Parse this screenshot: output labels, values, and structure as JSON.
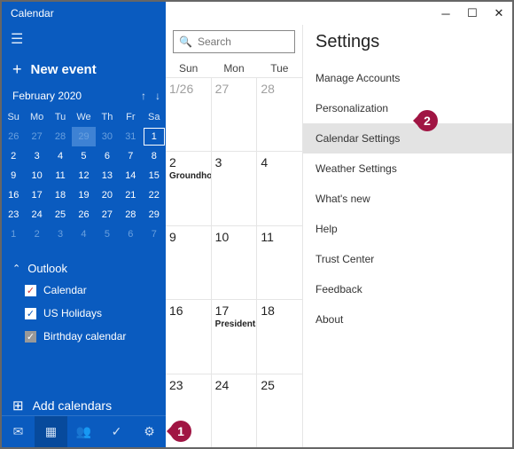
{
  "app_title": "Calendar",
  "sysbtns": {
    "min": "─",
    "max": "☐",
    "close": "✕"
  },
  "newevent": {
    "plus": "+",
    "label": "New event"
  },
  "month_label": "February 2020",
  "weekdays": [
    "Su",
    "Mo",
    "Tu",
    "We",
    "Th",
    "Fr",
    "Sa"
  ],
  "minical": [
    [
      {
        "d": "26",
        "dim": true
      },
      {
        "d": "27",
        "dim": true
      },
      {
        "d": "28",
        "dim": true
      },
      {
        "d": "29",
        "dim": true,
        "sel": true
      },
      {
        "d": "30",
        "dim": true
      },
      {
        "d": "31",
        "dim": true
      },
      {
        "d": "1",
        "today": true
      }
    ],
    [
      {
        "d": "2"
      },
      {
        "d": "3"
      },
      {
        "d": "4"
      },
      {
        "d": "5"
      },
      {
        "d": "6"
      },
      {
        "d": "7"
      },
      {
        "d": "8"
      }
    ],
    [
      {
        "d": "9"
      },
      {
        "d": "10"
      },
      {
        "d": "11"
      },
      {
        "d": "12"
      },
      {
        "d": "13"
      },
      {
        "d": "14"
      },
      {
        "d": "15"
      }
    ],
    [
      {
        "d": "16"
      },
      {
        "d": "17"
      },
      {
        "d": "18"
      },
      {
        "d": "19"
      },
      {
        "d": "20"
      },
      {
        "d": "21"
      },
      {
        "d": "22"
      }
    ],
    [
      {
        "d": "23"
      },
      {
        "d": "24"
      },
      {
        "d": "25"
      },
      {
        "d": "26"
      },
      {
        "d": "27"
      },
      {
        "d": "28"
      },
      {
        "d": "29"
      }
    ],
    [
      {
        "d": "1",
        "dim": true
      },
      {
        "d": "2",
        "dim": true
      },
      {
        "d": "3",
        "dim": true
      },
      {
        "d": "4",
        "dim": true
      },
      {
        "d": "5",
        "dim": true
      },
      {
        "d": "6",
        "dim": true
      },
      {
        "d": "7",
        "dim": true
      }
    ]
  ],
  "outlook_label": "Outlook",
  "calendars": [
    {
      "label": "Calendar",
      "variant": "red"
    },
    {
      "label": "US Holidays",
      "variant": "blue"
    },
    {
      "label": "Birthday calendar",
      "variant": "gray"
    }
  ],
  "add_calendars": "Add calendars",
  "search_placeholder": "Search",
  "big_weekdays": [
    "Sun",
    "Mon",
    "Tue"
  ],
  "weeks": [
    [
      {
        "n": "1/26",
        "dim": true
      },
      {
        "n": "27",
        "dim": true
      },
      {
        "n": "28",
        "dim": true
      }
    ],
    [
      {
        "n": "2",
        "evt": "Groundhog"
      },
      {
        "n": "3"
      },
      {
        "n": "4"
      }
    ],
    [
      {
        "n": "9"
      },
      {
        "n": "10"
      },
      {
        "n": "11"
      }
    ],
    [
      {
        "n": "16"
      },
      {
        "n": "17",
        "evt": "Presidents'"
      },
      {
        "n": "18"
      }
    ],
    [
      {
        "n": "23"
      },
      {
        "n": "24"
      },
      {
        "n": "25"
      }
    ]
  ],
  "settings_title": "Settings",
  "settings_items": [
    "Manage Accounts",
    "Personalization",
    "Calendar Settings",
    "Weather Settings",
    "What's new",
    "Help",
    "Trust Center",
    "Feedback",
    "About"
  ],
  "settings_active_index": 2,
  "callouts": {
    "c1": "1",
    "c2": "2"
  }
}
